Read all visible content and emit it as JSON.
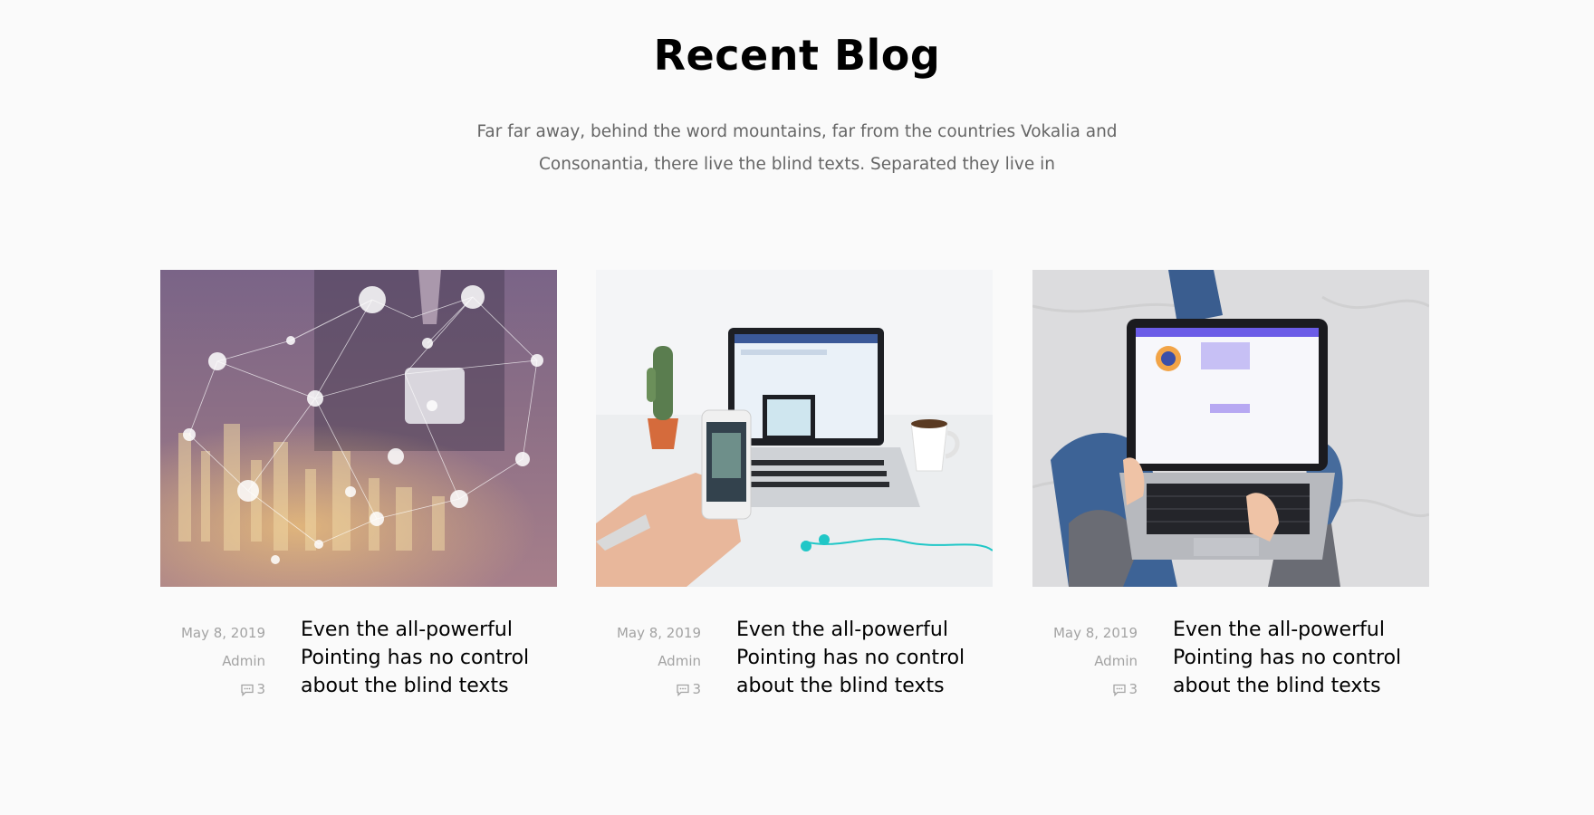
{
  "section": {
    "title": "Recent Blog",
    "subtitle_lines": [
      "Far far away, behind the word mountains, far from the countries Vokalia and",
      "Consonantia, there live the blind texts. Separated they live in"
    ]
  },
  "posts": [
    {
      "image": "city-network-tablet-photo",
      "date": "May 8, 2019",
      "author": "Admin",
      "comments": "3",
      "comment_icon": "chat-bubble-icon",
      "title_lines": [
        "Even the all-powerful",
        "Pointing has no control",
        "about the blind texts"
      ]
    },
    {
      "image": "laptop-phone-cactus-photo",
      "date": "May 8, 2019",
      "author": "Admin",
      "comments": "3",
      "comment_icon": "chat-bubble-icon",
      "title_lines": [
        "Even the all-powerful",
        "Pointing has no control",
        "about the blind texts"
      ]
    },
    {
      "image": "laptop-on-lap-photo",
      "date": "May 8, 2019",
      "author": "Admin",
      "comments": "3",
      "comment_icon": "chat-bubble-icon",
      "title_lines": [
        "Even the all-powerful",
        "Pointing has no control",
        "about the blind texts"
      ]
    }
  ]
}
